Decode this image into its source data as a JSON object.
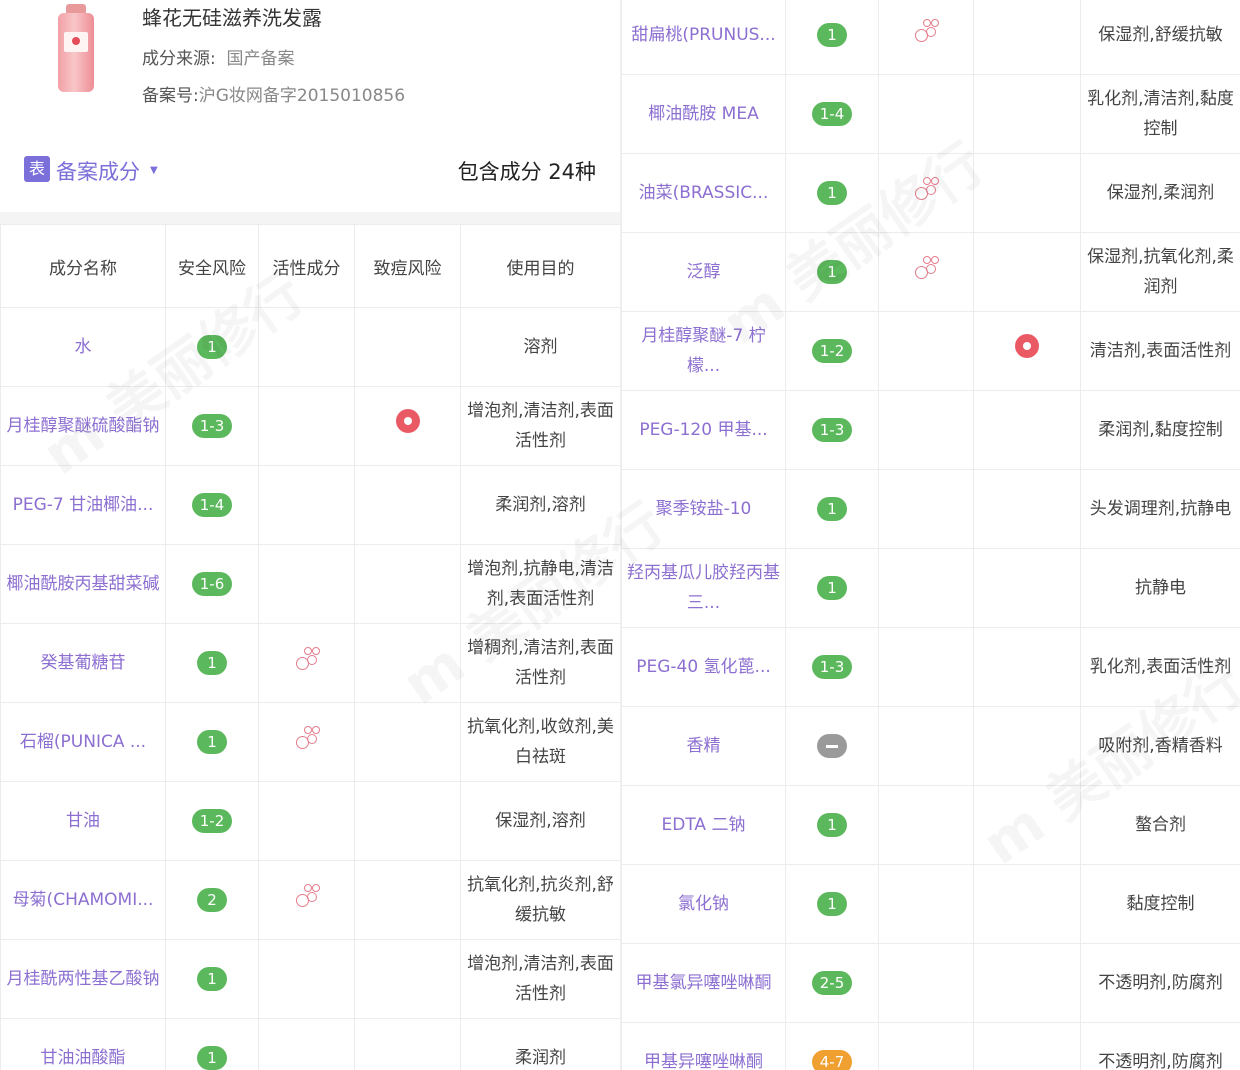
{
  "product": {
    "name": "蜂花无硅滋养洗发露",
    "source_label": "成分来源:",
    "source_value": "国产备案",
    "record_label": "备案号:",
    "record_value": "沪G妆网备字2015010856"
  },
  "section": {
    "tag": "表",
    "title": "备案成分",
    "count": "包含成分 24种"
  },
  "table": {
    "headers": [
      "成分名称",
      "安全风险",
      "活性成分",
      "致痘风险",
      "使用目的"
    ]
  },
  "left_rows": [
    {
      "name": "水",
      "risk": "1",
      "active": false,
      "acne": false,
      "purpose": "溶剂"
    },
    {
      "name": "月桂醇聚醚硫酸酯钠",
      "risk": "1-3",
      "active": false,
      "acne": true,
      "purpose": "增泡剂,清洁剂,表面活性剂"
    },
    {
      "name": "PEG-7 甘油椰油...",
      "risk": "1-4",
      "active": false,
      "acne": false,
      "purpose": "柔润剂,溶剂"
    },
    {
      "name": "椰油酰胺丙基甜菜碱",
      "risk": "1-6",
      "active": false,
      "acne": false,
      "purpose": "增泡剂,抗静电,清洁剂,表面活性剂"
    },
    {
      "name": "癸基葡糖苷",
      "risk": "1",
      "active": true,
      "acne": false,
      "purpose": "增稠剂,清洁剂,表面活性剂"
    },
    {
      "name": "石榴(PUNICA ...",
      "risk": "1",
      "active": true,
      "acne": false,
      "purpose": "抗氧化剂,收敛剂,美白祛斑"
    },
    {
      "name": "甘油",
      "risk": "1-2",
      "active": false,
      "acne": false,
      "purpose": "保湿剂,溶剂"
    },
    {
      "name": "母菊(CHAMOMI...",
      "risk": "2",
      "active": true,
      "acne": false,
      "purpose": "抗氧化剂,抗炎剂,舒缓抗敏"
    },
    {
      "name": "月桂酰两性基乙酸钠",
      "risk": "1",
      "active": false,
      "acne": false,
      "purpose": "增泡剂,清洁剂,表面活性剂"
    },
    {
      "name": "甘油油酸酯",
      "risk": "1",
      "active": false,
      "acne": false,
      "purpose": "柔润剂"
    }
  ],
  "right_rows": [
    {
      "name": "甜扁桃(PRUNUS...",
      "risk": "1",
      "active": true,
      "acne": false,
      "purpose": "保湿剂,舒缓抗敏"
    },
    {
      "name": "椰油酰胺 MEA",
      "risk": "1-4",
      "active": false,
      "acne": false,
      "purpose": "乳化剂,清洁剂,黏度控制"
    },
    {
      "name": "油菜(BRASSIC...",
      "risk": "1",
      "active": true,
      "acne": false,
      "purpose": "保湿剂,柔润剂"
    },
    {
      "name": "泛醇",
      "risk": "1",
      "active": true,
      "acne": false,
      "purpose": "保湿剂,抗氧化剂,柔润剂"
    },
    {
      "name": "月桂醇聚醚-7 柠檬...",
      "risk": "1-2",
      "active": false,
      "acne": true,
      "purpose": "清洁剂,表面活性剂"
    },
    {
      "name": "PEG-120 甲基...",
      "risk": "1-3",
      "active": false,
      "acne": false,
      "purpose": "柔润剂,黏度控制"
    },
    {
      "name": "聚季铵盐-10",
      "risk": "1",
      "active": false,
      "acne": false,
      "purpose": "头发调理剂,抗静电"
    },
    {
      "name": "羟丙基瓜儿胶羟丙基三...",
      "risk": "1",
      "active": false,
      "acne": false,
      "purpose": "抗静电"
    },
    {
      "name": "PEG-40 氢化蓖...",
      "risk": "1-3",
      "active": false,
      "acne": false,
      "purpose": "乳化剂,表面活性剂"
    },
    {
      "name": "香精",
      "risk": "",
      "risk_type": "gray",
      "active": false,
      "acne": false,
      "purpose": "吸附剂,香精香料"
    },
    {
      "name": "EDTA 二钠",
      "risk": "1",
      "active": false,
      "acne": false,
      "purpose": "螯合剂"
    },
    {
      "name": "氯化钠",
      "risk": "1",
      "active": false,
      "acne": false,
      "purpose": "黏度控制"
    },
    {
      "name": "甲基氯异噻唑啉酮",
      "risk": "2-5",
      "active": false,
      "acne": false,
      "purpose": "不透明剂,防腐剂"
    },
    {
      "name": "甲基异噻唑啉酮",
      "risk": "4-7",
      "risk_type": "orange",
      "active": false,
      "acne": false,
      "purpose": "不透明剂,防腐剂"
    }
  ],
  "colors": {
    "accent_purple": "#7b6fd9",
    "name_purple": "#8c6fd1",
    "risk_green": "#5cb85c",
    "risk_orange": "#f0a030",
    "acne_red": "#ea5a64"
  }
}
